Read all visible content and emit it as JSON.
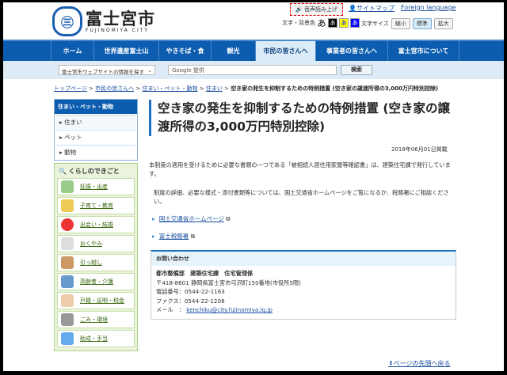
{
  "header": {
    "logo_jp": "富士宮市",
    "logo_en": "FUJINOMIYA CITY",
    "voice": "音声読み上げ",
    "sitemap": "サイトマップ",
    "foreign": "Foreign language",
    "color_label": "文字・背景色",
    "color_options": [
      "あ",
      "あ",
      "あ",
      "あ"
    ],
    "size_label": "文字サイズ",
    "size_options": [
      "縮小",
      "標準",
      "拡大"
    ]
  },
  "nav": [
    "ホーム",
    "世界遺産富士山",
    "やきそば・食",
    "観光",
    "市民の皆さんへ",
    "事業者の皆さんへ",
    "富士宮市について"
  ],
  "search": {
    "scope": "富士宮市ウェブサイトの情報を探す",
    "placeholder": "Google 提供",
    "button": "検索"
  },
  "breadcrumb": [
    "トップページ",
    "市民の皆さんへ",
    "住まい・ペット・動物",
    "住まい"
  ],
  "breadcrumb_current": "空き家の発生を抑制するための特例措置 (空き家の譲渡所得の3,000万円特別控除)",
  "sidebar": {
    "title": "住まい・ペット・動物",
    "items": [
      "住まい",
      "ペット",
      "動物"
    ],
    "life_title": "くらしのできごと",
    "life": [
      "妊娠・出産",
      "子育て・教育",
      "出会い・結婚",
      "おくやみ",
      "引っ越し",
      "高齢者・介護",
      "戸籍・証明・税金",
      "ごみ・環境",
      "助成・手当"
    ]
  },
  "main": {
    "title": "空き家の発生を抑制するための特例措置 (空き家の譲渡所得の3,000万円特別控除)",
    "date": "2018年06月01日掲載",
    "p1": "本制度の適用を受けるために必要な書類の一つである「被相続人居住用家屋等確認書」は、建築住宅課で発行しています。",
    "p2": "制度の詳細、必要な様式・添付書類等については、国土交通省ホームページをご覧になるか、税務署にご相談ください。",
    "links": [
      "国土交通省ホームページ",
      "富士税務署"
    ]
  },
  "contact": {
    "title": "お問い合わせ",
    "dept": "都市整備部　建築住宅課　住宅管理係",
    "address": "〒418-8601 静岡県富士宮市弓沢町150番地(市役所5階)",
    "tel": "電話番号：0544-22-1163",
    "fax": "ファクス：0544-22-1208",
    "mail_label": "メール　：",
    "mail": "kenchiku@city.fujinomiya.lg.jp"
  },
  "totop": "ページの先頭へ戻る"
}
